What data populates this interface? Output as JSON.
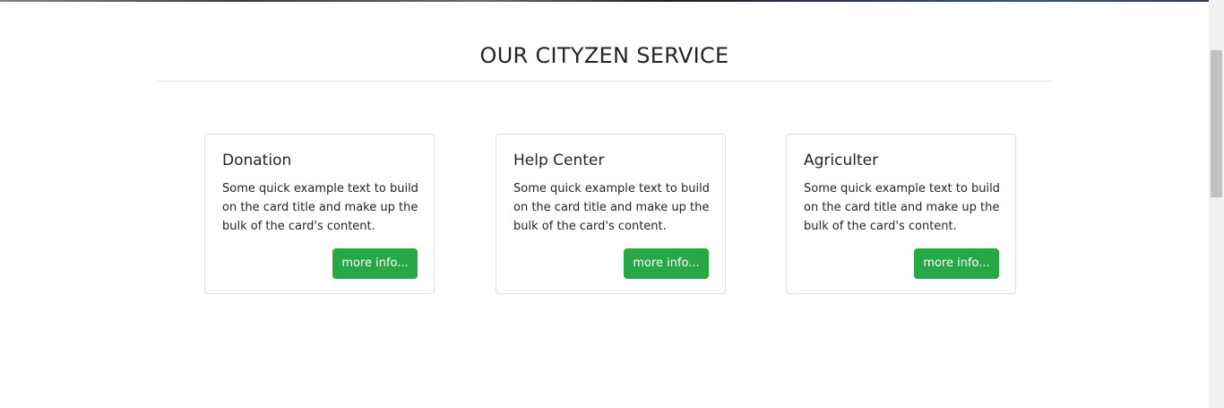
{
  "section": {
    "title": "OUR CITYZEN SERVICE"
  },
  "cards": [
    {
      "title": "Donation",
      "text": "Some quick example text to build on the card title and make up the bulk of the card's content.",
      "button": "more info..."
    },
    {
      "title": "Help Center",
      "text": "Some quick example text to build on the card title and make up the bulk of the card's content.",
      "button": "more info..."
    },
    {
      "title": "Agriculter",
      "text": "Some quick example text to build on the card title and make up the bulk of the card's content.",
      "button": "more info..."
    }
  ],
  "colors": {
    "button": "#28a745",
    "text": "#212529",
    "divider": "#dee2e6"
  }
}
